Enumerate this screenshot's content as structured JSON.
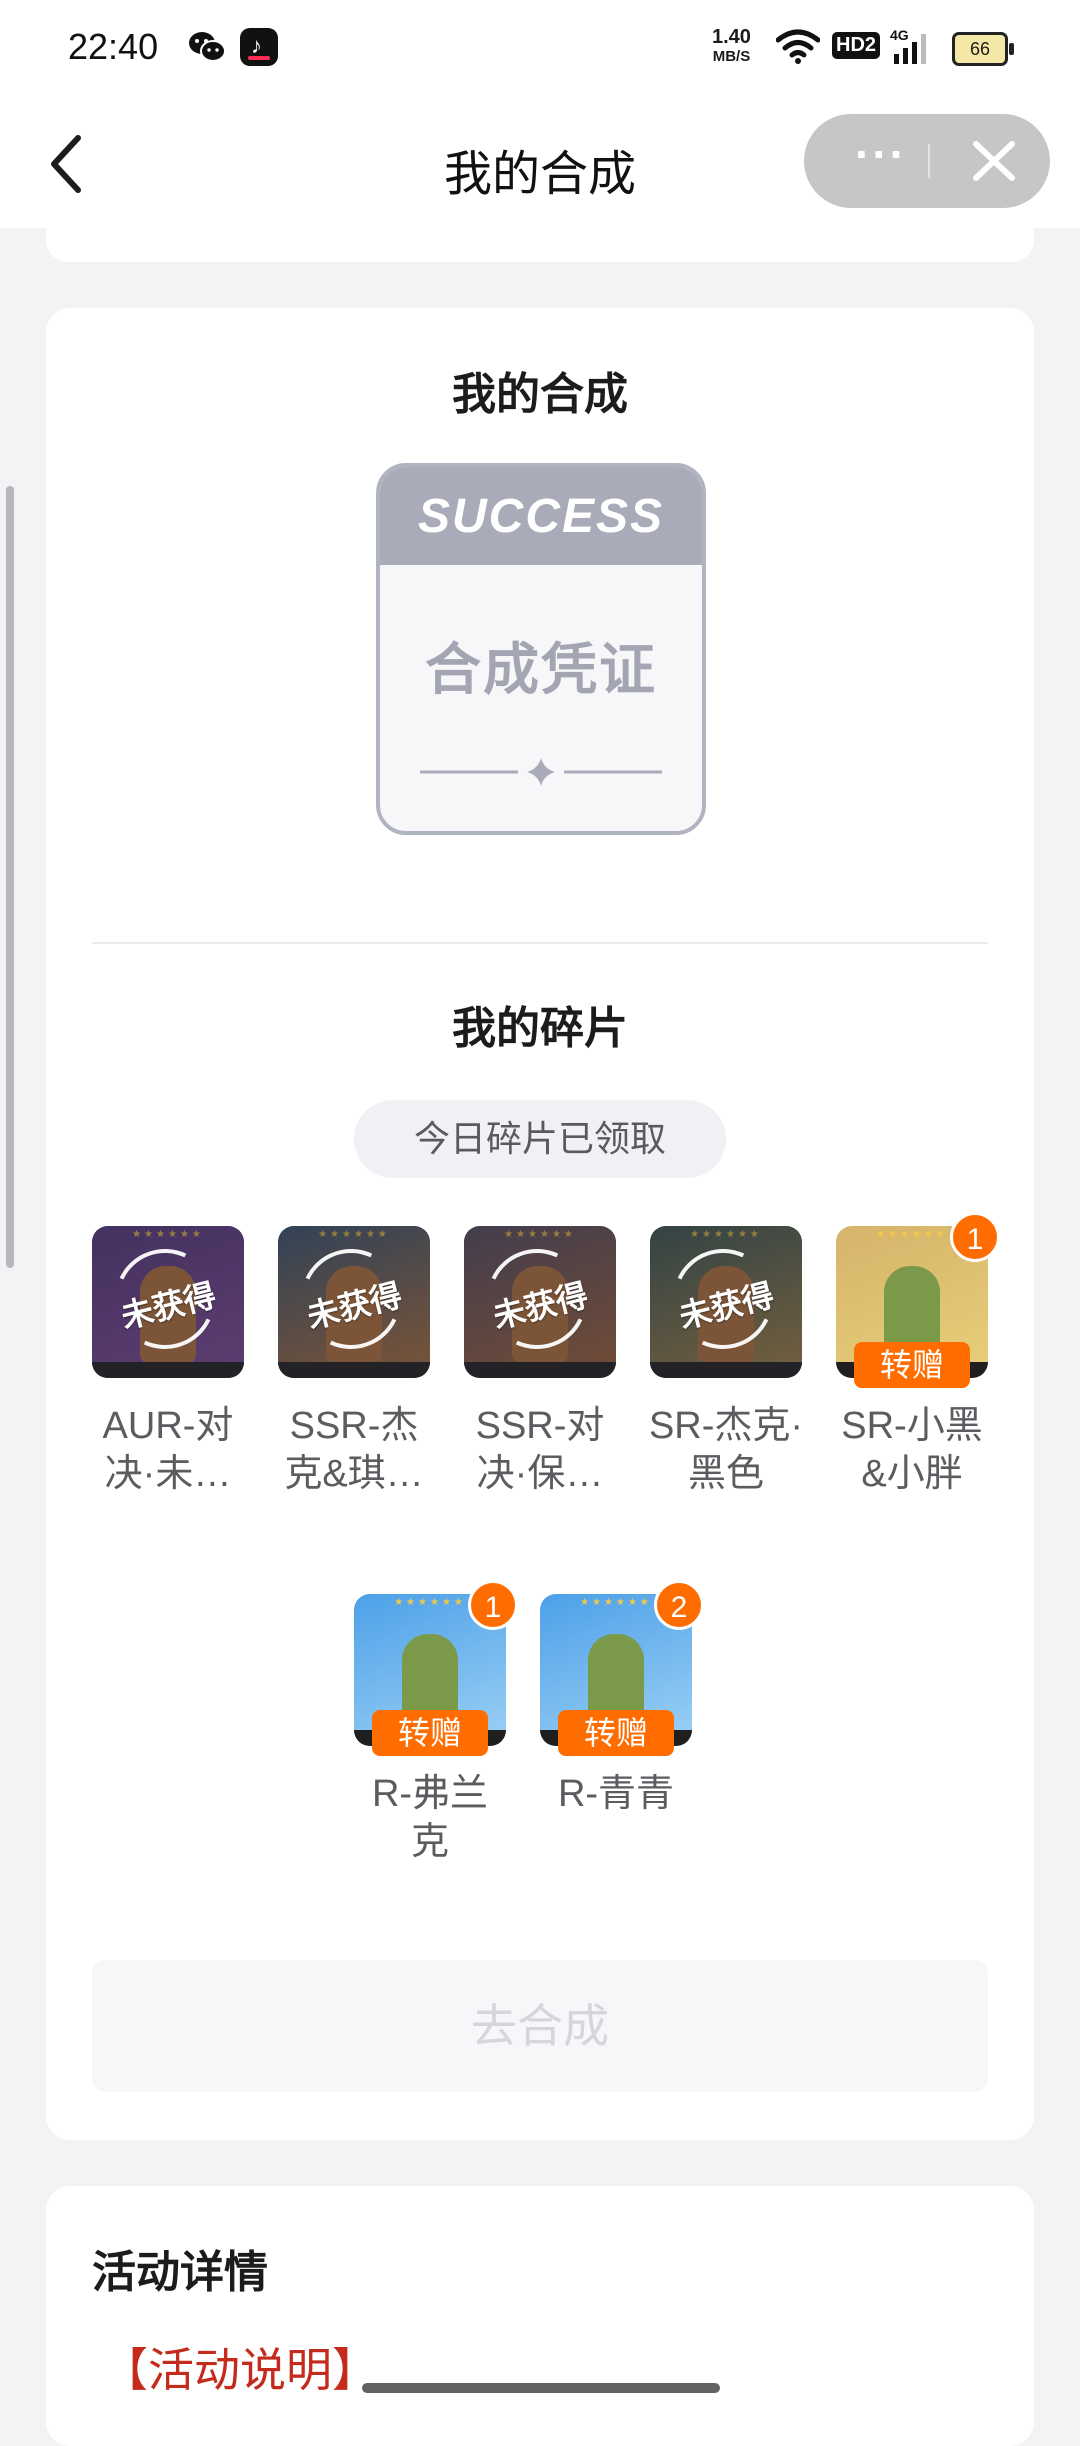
{
  "status_bar": {
    "time": "22:40",
    "net_speed": "1.40",
    "net_unit": "MB/S",
    "hd": "HD2",
    "network": "4G",
    "battery": "66",
    "icons": [
      "wechat-icon",
      "douyin-icon",
      "wifi-icon",
      "signal-icon",
      "battery-icon"
    ]
  },
  "header": {
    "title": "我的合成",
    "more": "···",
    "icons": [
      "back-arrow-icon",
      "more-icon",
      "close-icon"
    ]
  },
  "synthesis": {
    "title": "我的合成",
    "certificate": {
      "header": "SUCCESS",
      "label": "合成凭证"
    }
  },
  "fragments": {
    "title": "我的碎片",
    "claim_status": "今日碎片已领取",
    "locked_stamp": "未获得",
    "gift_label": "转赠",
    "items": [
      {
        "name": "AUR-对\n决·未…",
        "owned": false,
        "count": null,
        "colors": [
          "#5a3a86",
          "#8c4fa6"
        ]
      },
      {
        "name": "SSR-杰\n克&琪…",
        "owned": false,
        "count": null,
        "colors": [
          "#3b5877",
          "#c07a3c"
        ]
      },
      {
        "name": "SSR-对\n决·保…",
        "owned": false,
        "count": null,
        "colors": [
          "#5a4f66",
          "#b06b3a"
        ]
      },
      {
        "name": "SR-杰克·\n黑色",
        "owned": false,
        "count": null,
        "colors": [
          "#3c5a55",
          "#b58e4a"
        ]
      },
      {
        "name": "SR-小黑\n&小胖",
        "owned": true,
        "count": "1",
        "colors": [
          "#d6b46a",
          "#e8cf7a"
        ]
      },
      {
        "name": "R-弗兰\n克",
        "owned": true,
        "count": "1",
        "colors": [
          "#4da0e8",
          "#9cd1f5"
        ]
      },
      {
        "name": "R-青青",
        "owned": true,
        "count": "2",
        "colors": [
          "#4da0e8",
          "#9cd1f5"
        ]
      }
    ]
  },
  "actions": {
    "synthesize": "去合成"
  },
  "activity": {
    "title": "活动详情",
    "desc": "【活动说明】"
  }
}
